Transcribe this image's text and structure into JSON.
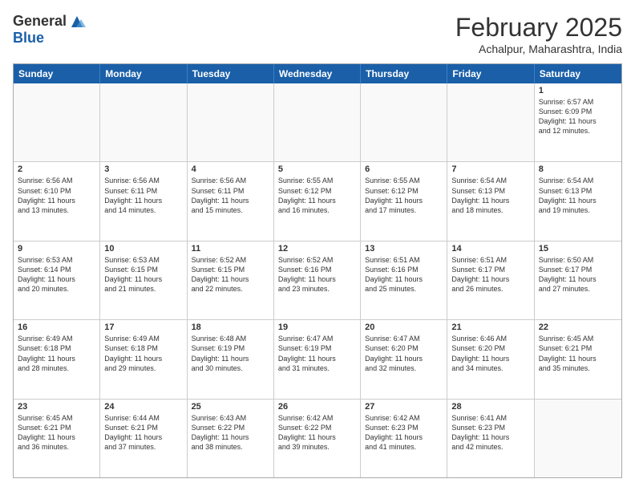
{
  "logo": {
    "general": "General",
    "blue": "Blue"
  },
  "title": "February 2025",
  "location": "Achalpur, Maharashtra, India",
  "header_days": [
    "Sunday",
    "Monday",
    "Tuesday",
    "Wednesday",
    "Thursday",
    "Friday",
    "Saturday"
  ],
  "weeks": [
    [
      {
        "day": "",
        "text": "",
        "empty": true
      },
      {
        "day": "",
        "text": "",
        "empty": true
      },
      {
        "day": "",
        "text": "",
        "empty": true
      },
      {
        "day": "",
        "text": "",
        "empty": true
      },
      {
        "day": "",
        "text": "",
        "empty": true
      },
      {
        "day": "",
        "text": "",
        "empty": true
      },
      {
        "day": "1",
        "text": "Sunrise: 6:57 AM\nSunset: 6:09 PM\nDaylight: 11 hours\nand 12 minutes.",
        "empty": false
      }
    ],
    [
      {
        "day": "2",
        "text": "Sunrise: 6:56 AM\nSunset: 6:10 PM\nDaylight: 11 hours\nand 13 minutes.",
        "empty": false
      },
      {
        "day": "3",
        "text": "Sunrise: 6:56 AM\nSunset: 6:11 PM\nDaylight: 11 hours\nand 14 minutes.",
        "empty": false
      },
      {
        "day": "4",
        "text": "Sunrise: 6:56 AM\nSunset: 6:11 PM\nDaylight: 11 hours\nand 15 minutes.",
        "empty": false
      },
      {
        "day": "5",
        "text": "Sunrise: 6:55 AM\nSunset: 6:12 PM\nDaylight: 11 hours\nand 16 minutes.",
        "empty": false
      },
      {
        "day": "6",
        "text": "Sunrise: 6:55 AM\nSunset: 6:12 PM\nDaylight: 11 hours\nand 17 minutes.",
        "empty": false
      },
      {
        "day": "7",
        "text": "Sunrise: 6:54 AM\nSunset: 6:13 PM\nDaylight: 11 hours\nand 18 minutes.",
        "empty": false
      },
      {
        "day": "8",
        "text": "Sunrise: 6:54 AM\nSunset: 6:13 PM\nDaylight: 11 hours\nand 19 minutes.",
        "empty": false
      }
    ],
    [
      {
        "day": "9",
        "text": "Sunrise: 6:53 AM\nSunset: 6:14 PM\nDaylight: 11 hours\nand 20 minutes.",
        "empty": false
      },
      {
        "day": "10",
        "text": "Sunrise: 6:53 AM\nSunset: 6:15 PM\nDaylight: 11 hours\nand 21 minutes.",
        "empty": false
      },
      {
        "day": "11",
        "text": "Sunrise: 6:52 AM\nSunset: 6:15 PM\nDaylight: 11 hours\nand 22 minutes.",
        "empty": false
      },
      {
        "day": "12",
        "text": "Sunrise: 6:52 AM\nSunset: 6:16 PM\nDaylight: 11 hours\nand 23 minutes.",
        "empty": false
      },
      {
        "day": "13",
        "text": "Sunrise: 6:51 AM\nSunset: 6:16 PM\nDaylight: 11 hours\nand 25 minutes.",
        "empty": false
      },
      {
        "day": "14",
        "text": "Sunrise: 6:51 AM\nSunset: 6:17 PM\nDaylight: 11 hours\nand 26 minutes.",
        "empty": false
      },
      {
        "day": "15",
        "text": "Sunrise: 6:50 AM\nSunset: 6:17 PM\nDaylight: 11 hours\nand 27 minutes.",
        "empty": false
      }
    ],
    [
      {
        "day": "16",
        "text": "Sunrise: 6:49 AM\nSunset: 6:18 PM\nDaylight: 11 hours\nand 28 minutes.",
        "empty": false
      },
      {
        "day": "17",
        "text": "Sunrise: 6:49 AM\nSunset: 6:18 PM\nDaylight: 11 hours\nand 29 minutes.",
        "empty": false
      },
      {
        "day": "18",
        "text": "Sunrise: 6:48 AM\nSunset: 6:19 PM\nDaylight: 11 hours\nand 30 minutes.",
        "empty": false
      },
      {
        "day": "19",
        "text": "Sunrise: 6:47 AM\nSunset: 6:19 PM\nDaylight: 11 hours\nand 31 minutes.",
        "empty": false
      },
      {
        "day": "20",
        "text": "Sunrise: 6:47 AM\nSunset: 6:20 PM\nDaylight: 11 hours\nand 32 minutes.",
        "empty": false
      },
      {
        "day": "21",
        "text": "Sunrise: 6:46 AM\nSunset: 6:20 PM\nDaylight: 11 hours\nand 34 minutes.",
        "empty": false
      },
      {
        "day": "22",
        "text": "Sunrise: 6:45 AM\nSunset: 6:21 PM\nDaylight: 11 hours\nand 35 minutes.",
        "empty": false
      }
    ],
    [
      {
        "day": "23",
        "text": "Sunrise: 6:45 AM\nSunset: 6:21 PM\nDaylight: 11 hours\nand 36 minutes.",
        "empty": false
      },
      {
        "day": "24",
        "text": "Sunrise: 6:44 AM\nSunset: 6:21 PM\nDaylight: 11 hours\nand 37 minutes.",
        "empty": false
      },
      {
        "day": "25",
        "text": "Sunrise: 6:43 AM\nSunset: 6:22 PM\nDaylight: 11 hours\nand 38 minutes.",
        "empty": false
      },
      {
        "day": "26",
        "text": "Sunrise: 6:42 AM\nSunset: 6:22 PM\nDaylight: 11 hours\nand 39 minutes.",
        "empty": false
      },
      {
        "day": "27",
        "text": "Sunrise: 6:42 AM\nSunset: 6:23 PM\nDaylight: 11 hours\nand 41 minutes.",
        "empty": false
      },
      {
        "day": "28",
        "text": "Sunrise: 6:41 AM\nSunset: 6:23 PM\nDaylight: 11 hours\nand 42 minutes.",
        "empty": false
      },
      {
        "day": "",
        "text": "",
        "empty": true
      }
    ]
  ]
}
